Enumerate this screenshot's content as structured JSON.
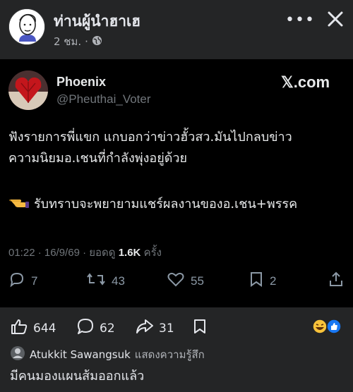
{
  "fb_post": {
    "page_name": "ท่านผู้นำฮาเฮ",
    "time": "2 ชม.",
    "separator": "·"
  },
  "x_post": {
    "display_name": "Phoenix",
    "handle": "@Pheuthai_Voter",
    "brand": "𝕏.com",
    "text_line1": "ฟังรายการพี่แขก แกบอกว่าข่าวฮั้วสว.มันไปกลบข่าว",
    "text_line2": "ความนิยมอ.เชนที่กำลังพุ่งอยู่ด้วย",
    "text_line3": "รับทราบจะพยายามแชร์ผลงานของอ.เชน+พรรค",
    "timestamp": "01:22 · 16/9/69 · ยอดดู",
    "views": "1.6K",
    "views_suffix": "ครั้ง",
    "replies": "7",
    "reposts": "43",
    "likes": "55",
    "bookmarks": "2"
  },
  "fb_actions": {
    "likes": "644",
    "comments": "62",
    "shares": "31"
  },
  "comment": {
    "author": "Atukkit Sawangsuk",
    "action": "แสดงความรู้สึก",
    "text": "มีคนมองแผนส้มออกแล้ว"
  },
  "colors": {
    "fb_bg": "#242526",
    "x_bg": "#000000",
    "like_blue": "#1877f2"
  }
}
